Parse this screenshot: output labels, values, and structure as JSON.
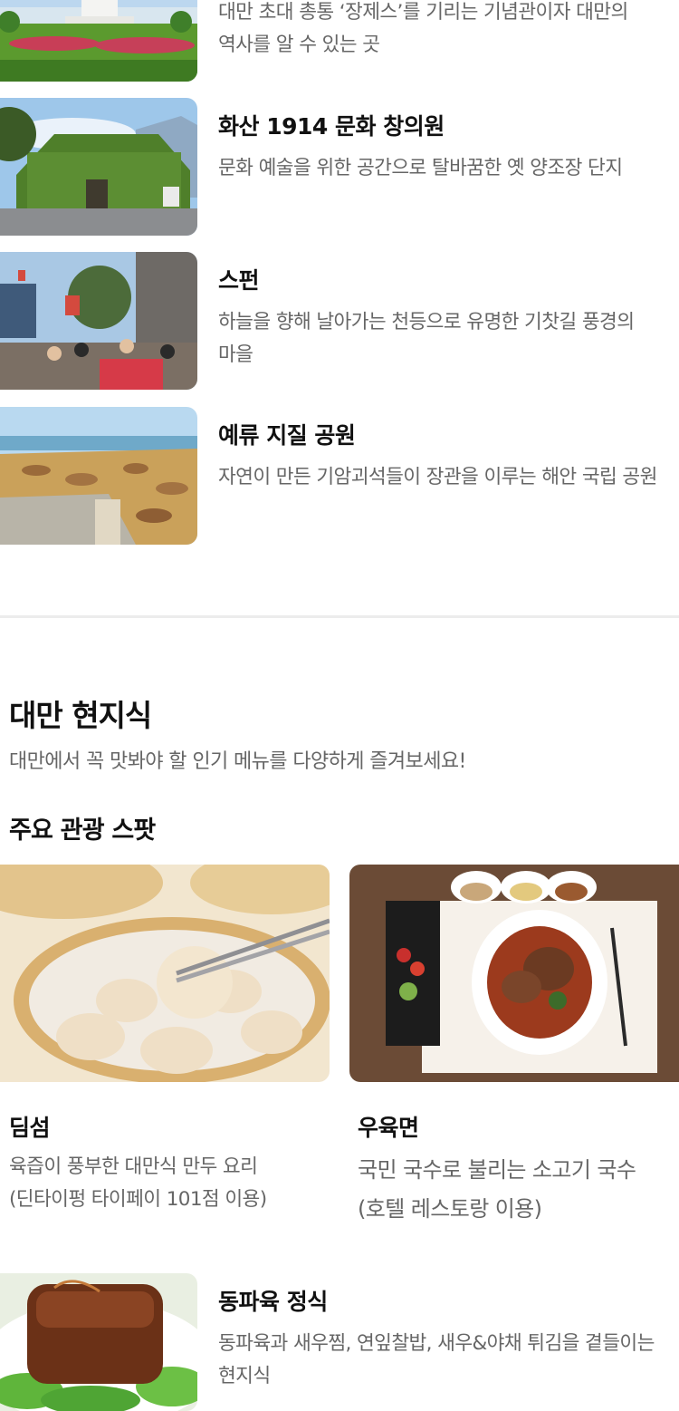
{
  "spots": [
    {
      "title": "",
      "desc": "대만 초대 총통 ‘장제스’를 기리는 기념관이자 대만의 역사를 알 수 있는 곳",
      "image": "memorial-hall-photo"
    },
    {
      "title": "화산 1914 문화 창의원",
      "desc": "문화 예술을 위한 공간으로 탈바꿈한 옛 양조장 단지",
      "image": "ivy-covered-building-photo"
    },
    {
      "title": "스펀",
      "desc": "하늘을 향해 날아가는 천등으로 유명한 기찻길 풍경의 마을",
      "image": "railway-street-lanterns-photo"
    },
    {
      "title": "예류 지질 공원",
      "desc": "자연이 만든 기암괴석들이 장관을 이루는 해안 국립 공원",
      "image": "coastal-rock-park-photo"
    }
  ],
  "local_food": {
    "title": "대만 현지식",
    "subtitle": "대만에서 꼭 맛봐야 할 인기 메뉴를 다양하게 즐겨보세요!",
    "subsection_title": "주요 관광 스팟",
    "items": [
      {
        "title": "딤섬",
        "desc": "육즙이 풍부한 대만식 만두 요리 (딘타이펑 타이페이 101점 이용)",
        "image": "dumplings-photo"
      },
      {
        "title": "우육면",
        "desc": "국민 국수로 불리는 소고기 국수 (호텔 레스토랑 이용)",
        "image": "beef-noodle-soup-photo"
      },
      {
        "title": "동파육 정식",
        "desc": "동파육과 새우찜, 연잎찰밥, 새우&야채 튀김을 곁들이는 현지식",
        "image": "braised-pork-photo"
      }
    ]
  },
  "colors": {
    "title": "#111111",
    "description": "#666666",
    "divider": "#ececec"
  }
}
